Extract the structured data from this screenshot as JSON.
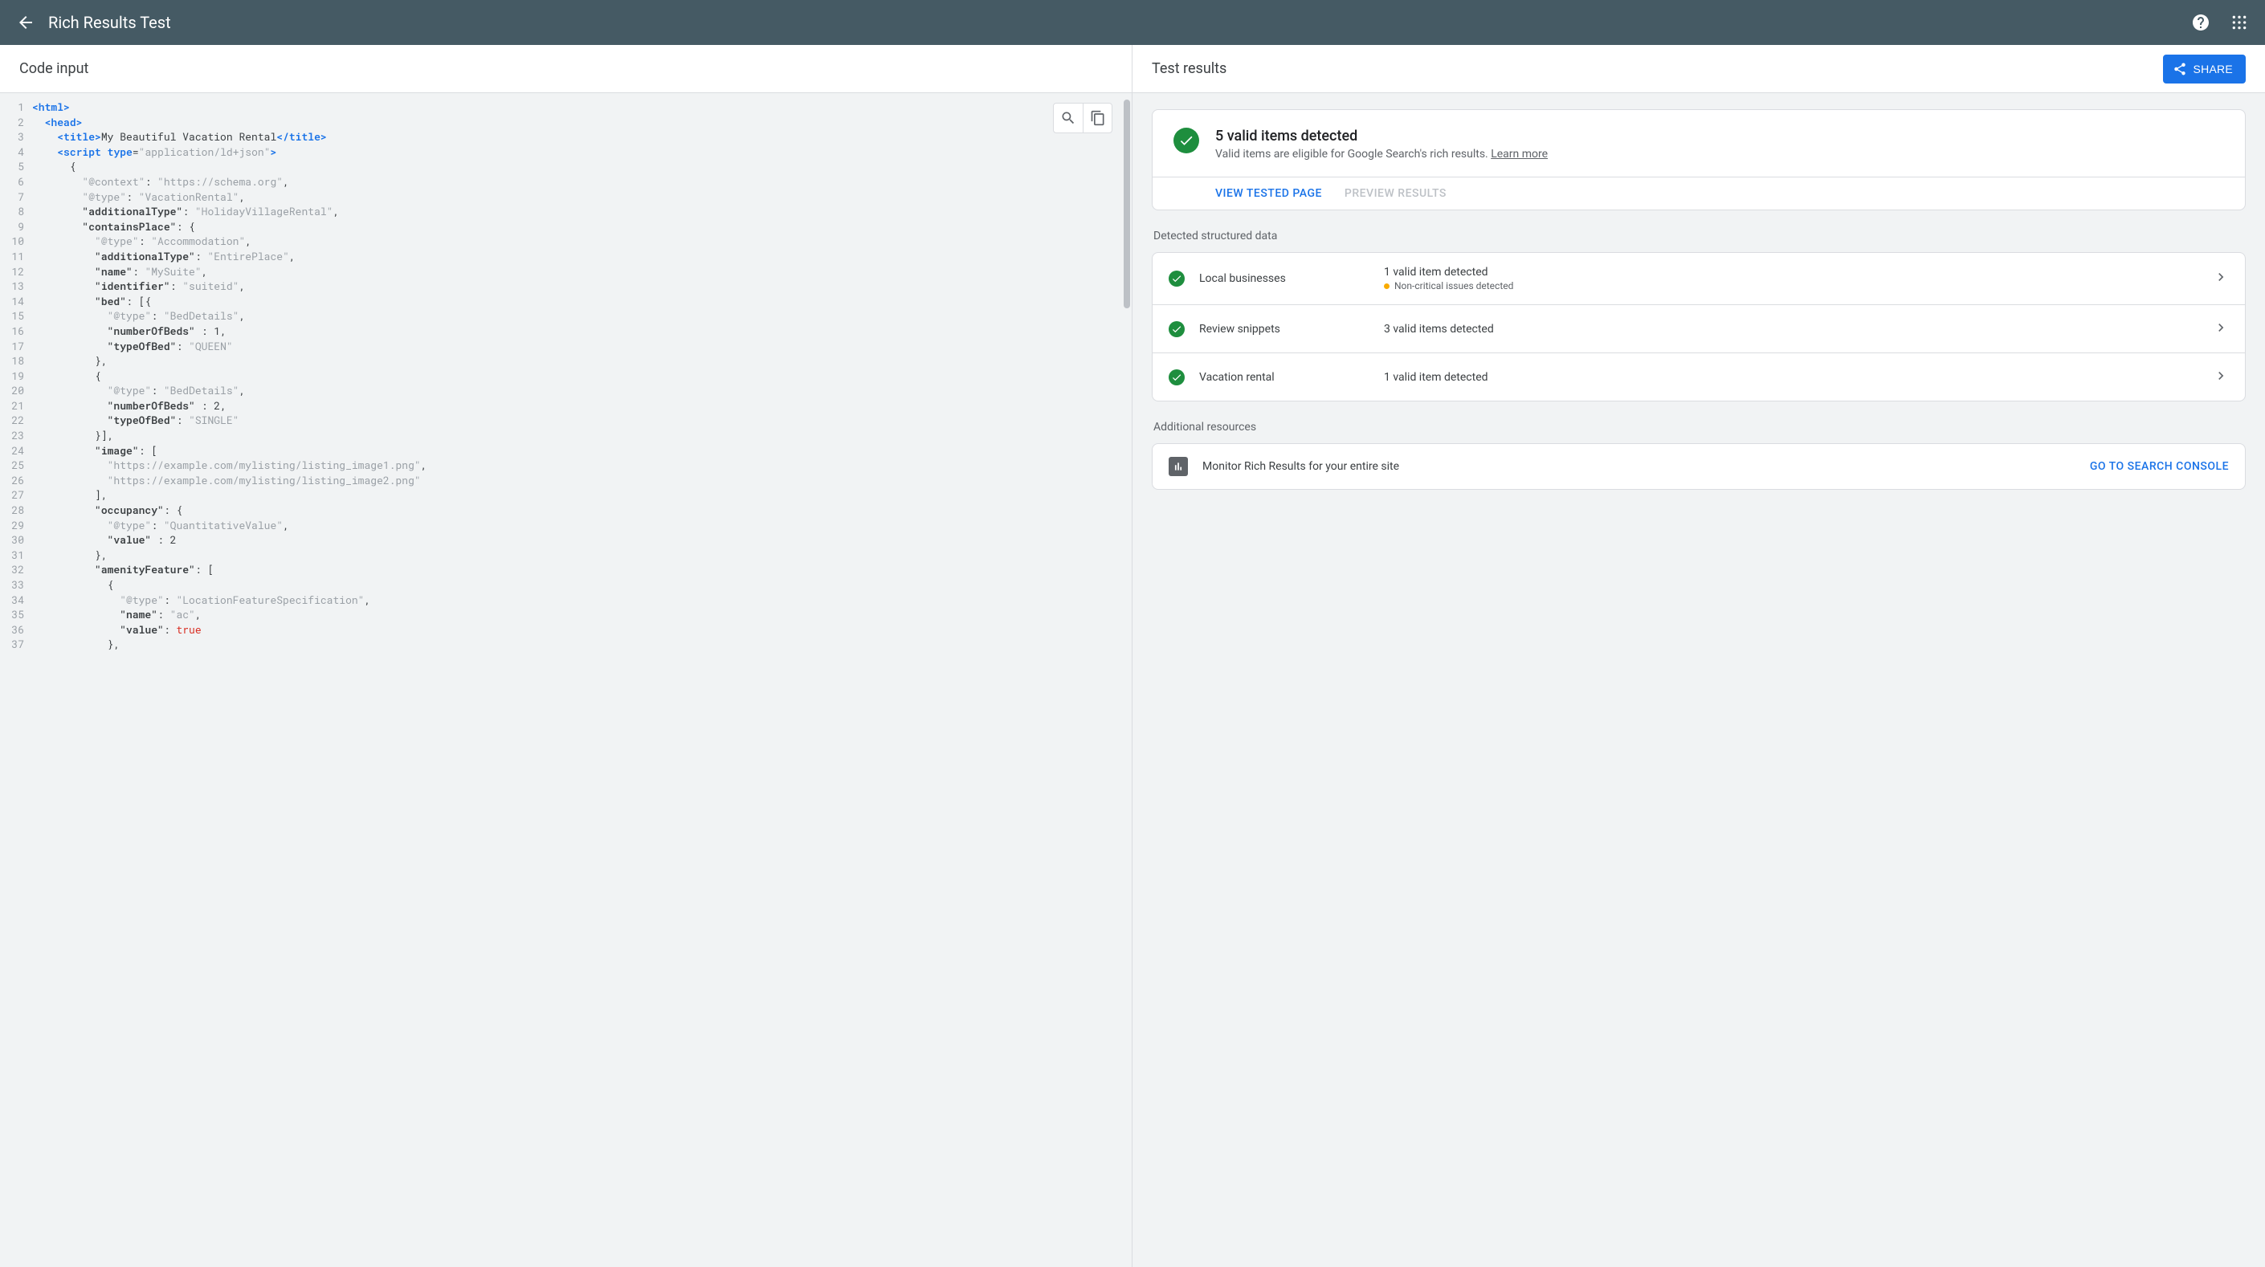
{
  "header": {
    "title": "Rich Results Test"
  },
  "left": {
    "title": "Code input",
    "code_lines": [
      {
        "n": 1,
        "tokens": [
          [
            "tag",
            "<html>"
          ]
        ]
      },
      {
        "n": 2,
        "tokens": [
          [
            "punc",
            "  "
          ],
          [
            "tag",
            "<head>"
          ]
        ]
      },
      {
        "n": 3,
        "tokens": [
          [
            "punc",
            "    "
          ],
          [
            "tag",
            "<title>"
          ],
          [
            "punc",
            "My Beautiful Vacation Rental"
          ],
          [
            "tag",
            "</title>"
          ]
        ]
      },
      {
        "n": 4,
        "tokens": [
          [
            "punc",
            "    "
          ],
          [
            "tag",
            "<script "
          ],
          [
            "attr",
            "type"
          ],
          [
            "punc",
            "="
          ],
          [
            "str",
            "\"application/ld+json\""
          ],
          [
            "tag",
            ">"
          ]
        ]
      },
      {
        "n": 5,
        "tokens": [
          [
            "punc",
            "      {"
          ]
        ]
      },
      {
        "n": 6,
        "tokens": [
          [
            "punc",
            "        "
          ],
          [
            "muted",
            "\"@context\""
          ],
          [
            "punc",
            ": "
          ],
          [
            "str",
            "\"https://schema.org\""
          ],
          [
            "punc",
            ","
          ]
        ]
      },
      {
        "n": 7,
        "tokens": [
          [
            "punc",
            "        "
          ],
          [
            "muted",
            "\"@type\""
          ],
          [
            "punc",
            ": "
          ],
          [
            "str",
            "\"VacationRental\""
          ],
          [
            "punc",
            ","
          ]
        ]
      },
      {
        "n": 8,
        "tokens": [
          [
            "punc",
            "        "
          ],
          [
            "key",
            "\"additionalType\""
          ],
          [
            "punc",
            ": "
          ],
          [
            "str",
            "\"HolidayVillageRental\""
          ],
          [
            "punc",
            ","
          ]
        ]
      },
      {
        "n": 9,
        "tokens": [
          [
            "punc",
            "        "
          ],
          [
            "key",
            "\"containsPlace\""
          ],
          [
            "punc",
            ": {"
          ]
        ]
      },
      {
        "n": 10,
        "tokens": [
          [
            "punc",
            "          "
          ],
          [
            "muted",
            "\"@type\""
          ],
          [
            "punc",
            ": "
          ],
          [
            "str",
            "\"Accommodation\""
          ],
          [
            "punc",
            ","
          ]
        ]
      },
      {
        "n": 11,
        "tokens": [
          [
            "punc",
            "          "
          ],
          [
            "key",
            "\"additionalType\""
          ],
          [
            "punc",
            ": "
          ],
          [
            "str",
            "\"EntirePlace\""
          ],
          [
            "punc",
            ","
          ]
        ]
      },
      {
        "n": 12,
        "tokens": [
          [
            "punc",
            "          "
          ],
          [
            "key",
            "\"name\""
          ],
          [
            "punc",
            ": "
          ],
          [
            "str",
            "\"MySuite\""
          ],
          [
            "punc",
            ","
          ]
        ]
      },
      {
        "n": 13,
        "tokens": [
          [
            "punc",
            "          "
          ],
          [
            "key",
            "\"identifier\""
          ],
          [
            "punc",
            ": "
          ],
          [
            "str",
            "\"suiteid\""
          ],
          [
            "punc",
            ","
          ]
        ]
      },
      {
        "n": 14,
        "tokens": [
          [
            "punc",
            "          "
          ],
          [
            "key",
            "\"bed\""
          ],
          [
            "punc",
            ": [{"
          ]
        ]
      },
      {
        "n": 15,
        "tokens": [
          [
            "punc",
            "            "
          ],
          [
            "muted",
            "\"@type\""
          ],
          [
            "punc",
            ": "
          ],
          [
            "str",
            "\"BedDetails\""
          ],
          [
            "punc",
            ","
          ]
        ]
      },
      {
        "n": 16,
        "tokens": [
          [
            "punc",
            "            "
          ],
          [
            "key",
            "\"numberOfBeds\""
          ],
          [
            "punc",
            " : "
          ],
          [
            "num",
            "1"
          ],
          [
            "punc",
            ","
          ]
        ]
      },
      {
        "n": 17,
        "tokens": [
          [
            "punc",
            "            "
          ],
          [
            "key",
            "\"typeOfBed\""
          ],
          [
            "punc",
            ": "
          ],
          [
            "str",
            "\"QUEEN\""
          ]
        ]
      },
      {
        "n": 18,
        "tokens": [
          [
            "punc",
            "          },"
          ]
        ]
      },
      {
        "n": 19,
        "tokens": [
          [
            "punc",
            "          {"
          ]
        ]
      },
      {
        "n": 20,
        "tokens": [
          [
            "punc",
            "            "
          ],
          [
            "muted",
            "\"@type\""
          ],
          [
            "punc",
            ": "
          ],
          [
            "str",
            "\"BedDetails\""
          ],
          [
            "punc",
            ","
          ]
        ]
      },
      {
        "n": 21,
        "tokens": [
          [
            "punc",
            "            "
          ],
          [
            "key",
            "\"numberOfBeds\""
          ],
          [
            "punc",
            " : "
          ],
          [
            "num",
            "2"
          ],
          [
            "punc",
            ","
          ]
        ]
      },
      {
        "n": 22,
        "tokens": [
          [
            "punc",
            "            "
          ],
          [
            "key",
            "\"typeOfBed\""
          ],
          [
            "punc",
            ": "
          ],
          [
            "str",
            "\"SINGLE\""
          ]
        ]
      },
      {
        "n": 23,
        "tokens": [
          [
            "punc",
            "          }],"
          ]
        ]
      },
      {
        "n": 24,
        "tokens": [
          [
            "punc",
            "          "
          ],
          [
            "key",
            "\"image\""
          ],
          [
            "punc",
            ": ["
          ]
        ]
      },
      {
        "n": 25,
        "tokens": [
          [
            "punc",
            "            "
          ],
          [
            "str",
            "\"https://example.com/mylisting/listing_image1.png\""
          ],
          [
            "punc",
            ","
          ]
        ]
      },
      {
        "n": 26,
        "tokens": [
          [
            "punc",
            "            "
          ],
          [
            "str",
            "\"https://example.com/mylisting/listing_image2.png\""
          ]
        ]
      },
      {
        "n": 27,
        "tokens": [
          [
            "punc",
            "          ],"
          ]
        ]
      },
      {
        "n": 28,
        "tokens": [
          [
            "punc",
            "          "
          ],
          [
            "key",
            "\"occupancy\""
          ],
          [
            "punc",
            ": {"
          ]
        ]
      },
      {
        "n": 29,
        "tokens": [
          [
            "punc",
            "            "
          ],
          [
            "muted",
            "\"@type\""
          ],
          [
            "punc",
            ": "
          ],
          [
            "str",
            "\"QuantitativeValue\""
          ],
          [
            "punc",
            ","
          ]
        ]
      },
      {
        "n": 30,
        "tokens": [
          [
            "punc",
            "            "
          ],
          [
            "key",
            "\"value\""
          ],
          [
            "punc",
            " : "
          ],
          [
            "num",
            "2"
          ]
        ]
      },
      {
        "n": 31,
        "tokens": [
          [
            "punc",
            "          },"
          ]
        ]
      },
      {
        "n": 32,
        "tokens": [
          [
            "punc",
            "          "
          ],
          [
            "key",
            "\"amenityFeature\""
          ],
          [
            "punc",
            ": ["
          ]
        ]
      },
      {
        "n": 33,
        "tokens": [
          [
            "punc",
            "            {"
          ]
        ]
      },
      {
        "n": 34,
        "tokens": [
          [
            "punc",
            "              "
          ],
          [
            "muted",
            "\"@type\""
          ],
          [
            "punc",
            ": "
          ],
          [
            "str",
            "\"LocationFeatureSpecification\""
          ],
          [
            "punc",
            ","
          ]
        ]
      },
      {
        "n": 35,
        "tokens": [
          [
            "punc",
            "              "
          ],
          [
            "key",
            "\"name\""
          ],
          [
            "punc",
            ": "
          ],
          [
            "str",
            "\"ac\""
          ],
          [
            "punc",
            ","
          ]
        ]
      },
      {
        "n": 36,
        "tokens": [
          [
            "punc",
            "              "
          ],
          [
            "key",
            "\"value\""
          ],
          [
            "punc",
            ": "
          ],
          [
            "bool",
            "true"
          ]
        ]
      },
      {
        "n": 37,
        "tokens": [
          [
            "punc",
            "            },"
          ]
        ]
      }
    ]
  },
  "right": {
    "title": "Test results",
    "share_label": "SHARE",
    "summary": {
      "headline": "5 valid items detected",
      "sub": "Valid items are eligible for Google Search's rich results. ",
      "learn": "Learn more",
      "action_view": "VIEW TESTED PAGE",
      "action_preview": "PREVIEW RESULTS"
    },
    "detected_label": "Detected structured data",
    "detected": [
      {
        "name": "Local businesses",
        "status": "1 valid item detected",
        "warn": "Non-critical issues detected"
      },
      {
        "name": "Review snippets",
        "status": "3 valid items detected",
        "warn": null
      },
      {
        "name": "Vacation rental",
        "status": "1 valid item detected",
        "warn": null
      }
    ],
    "resources_label": "Additional resources",
    "resource": {
      "text": "Monitor Rich Results for your entire site",
      "link": "GO TO SEARCH CONSOLE"
    }
  }
}
